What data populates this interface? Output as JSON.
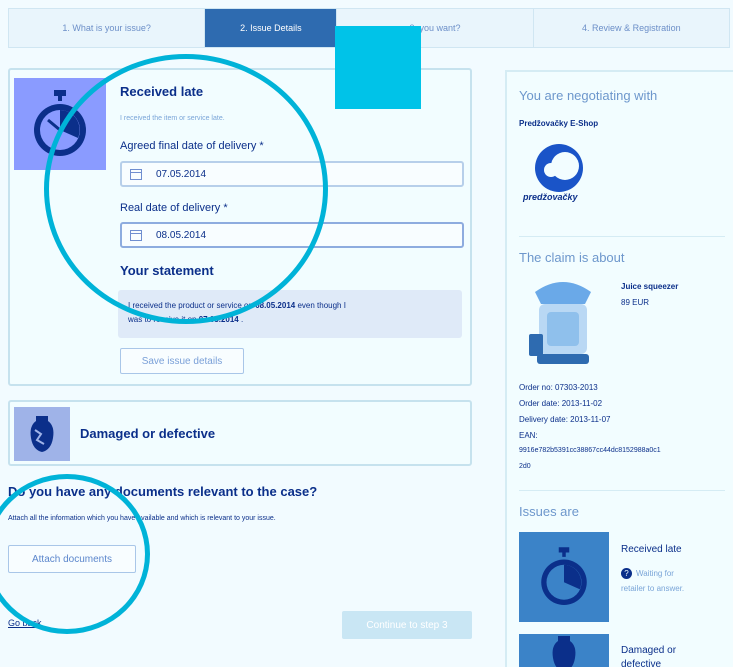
{
  "steps": [
    {
      "label": "1. What is your issue?"
    },
    {
      "label": "2. Issue Details"
    },
    {
      "label": "3.  you want?"
    },
    {
      "label": "4. Review & Registration"
    }
  ],
  "issue_late": {
    "title": "Received late",
    "subtitle": "I received the item or service late.",
    "agreed_label": "Agreed final date of delivery *",
    "agreed_value": "07.05.2014",
    "real_label": "Real date of delivery *",
    "real_value": "08.05.2014",
    "statement_title": "Your statement",
    "statement_part1": "I received the product or service on ",
    "statement_date1": "08.05.2014",
    "statement_part2": " even though I",
    "statement_part3": "was to receive it on ",
    "statement_date2": "07.05.2014",
    "statement_part4": " .",
    "save_button": "Save issue details"
  },
  "issue_damaged": {
    "title": "Damaged or defective"
  },
  "documents": {
    "heading": "Do you have any documents relevant to the case?",
    "hint": "Attach all the information which you have available and which is relevant to your issue.",
    "attach_button": "Attach documents"
  },
  "footer": {
    "go_back": "Go back",
    "continue_button": "Continue to step 3"
  },
  "sidebar": {
    "negotiating_heading": "You are negotiating with",
    "shop_name": "Predžovačky E-Shop",
    "logo_text": "predžovačky",
    "claim_heading": "The claim is about",
    "product_name": "Juice squeezer",
    "product_price": "89 EUR",
    "order_no": "Order no: 07303-2013",
    "order_date": "Order date: 2013-11-02",
    "delivery_date": "Delivery date: 2013-11-07",
    "ean_label": "EAN:",
    "ean_value_line1": "9916e782b5391cc38867cc44dc8152988a0c1",
    "ean_value_line2": "2d0",
    "issues_heading": "Issues are",
    "issue1_title": "Received late",
    "issue1_status_line1": "Waiting for",
    "issue1_status_line2": "retailer to answer.",
    "issue2_title_line1": "Damaged or",
    "issue2_title_line2": "defective"
  },
  "colors": {
    "accent": "#2e6bb0",
    "highlight": "#00c3e8",
    "text": "#0b2f8a"
  }
}
